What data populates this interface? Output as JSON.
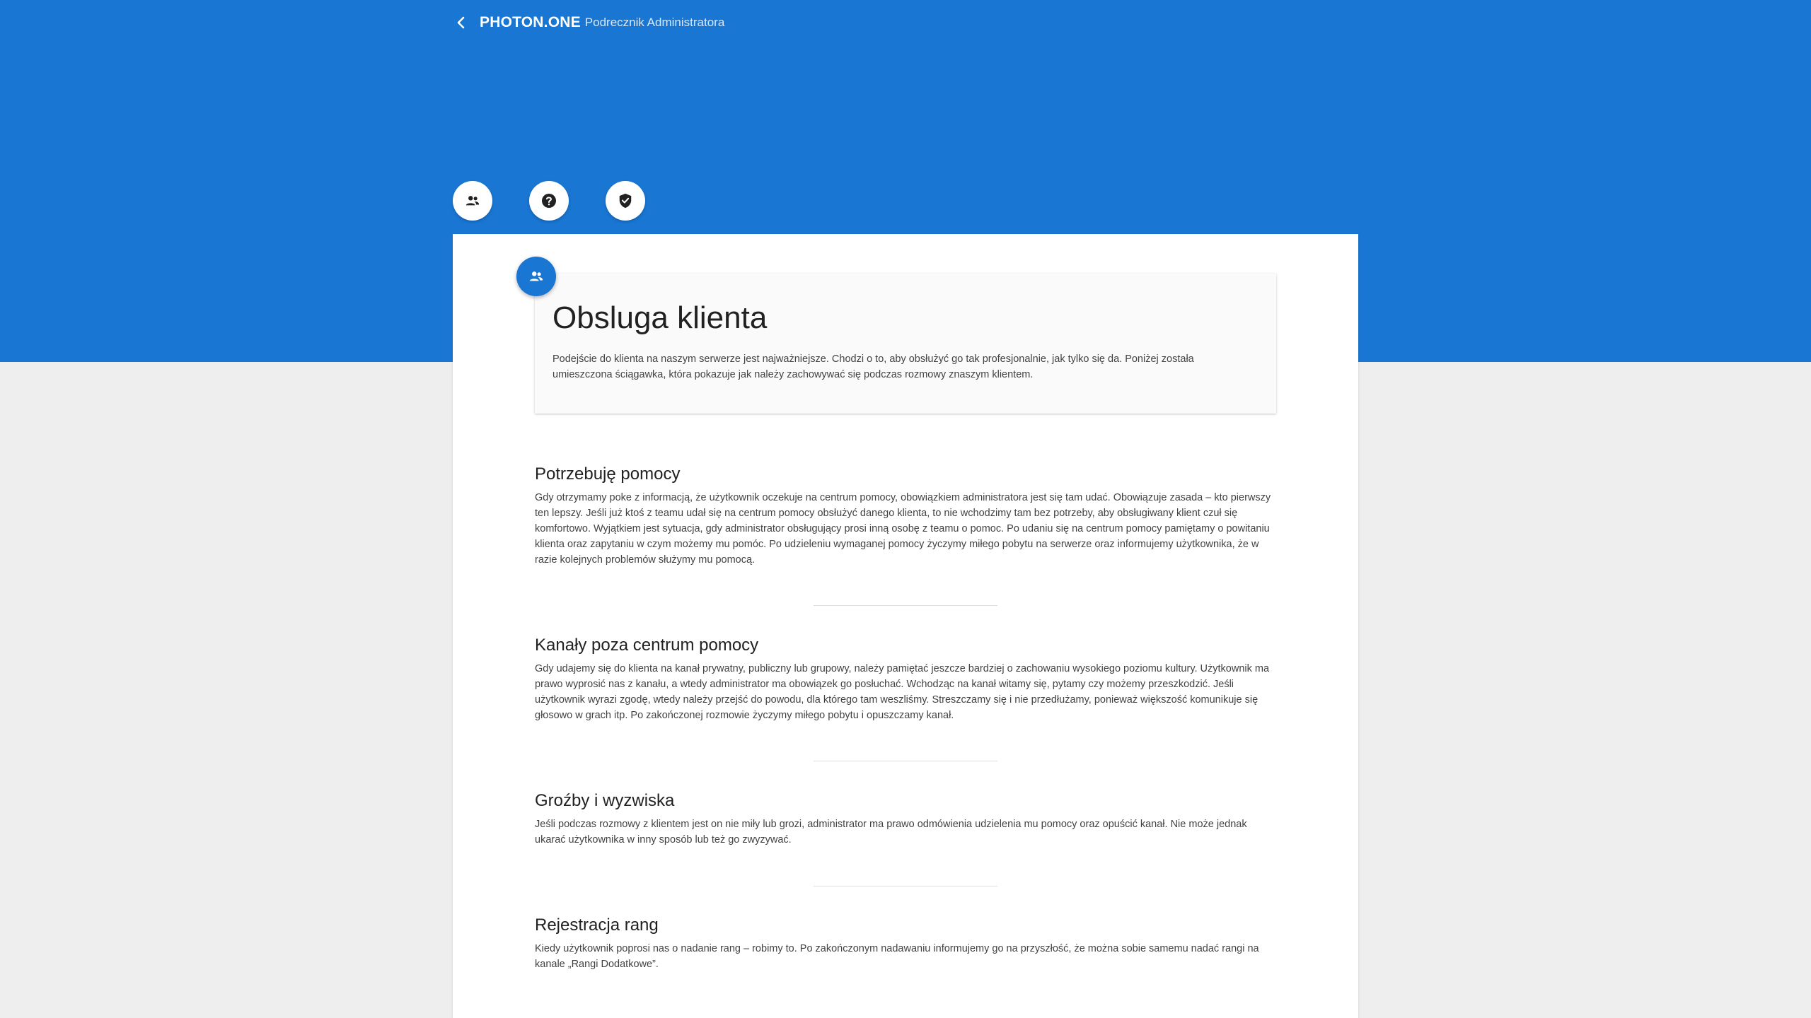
{
  "header": {
    "brand": "PHOTON.ONE",
    "subtitle": "Podrecznik Administratora",
    "back_icon": "chevron-left-icon"
  },
  "colors": {
    "primary": "#1976d2",
    "background": "#eeeeee",
    "card": "#ffffff"
  },
  "tabs": [
    {
      "icon": "people-icon"
    },
    {
      "icon": "help-circle-icon"
    },
    {
      "icon": "shield-check-icon"
    }
  ],
  "intro": {
    "icon": "people-icon",
    "title": "Obsluga klienta",
    "text": "Podejście do klienta na naszym serwerze jest najważniejsze. Chodzi o to, aby obsłużyć go tak profesjonalnie, jak tylko się da. Poniżej została umieszczona ściągawka, która pokazuje jak należy zachowywać się podczas rozmowy znaszym klientem."
  },
  "sections": [
    {
      "title": "Potrzebuję pomocy",
      "text": "Gdy otrzymamy poke z informacją, że użytkownik oczekuje na centrum pomocy, obowiązkiem administratora jest się tam udać. Obowiązuje zasada – kto pierwszy ten lepszy. Jeśli już ktoś z teamu udał się na centrum pomocy obsłużyć danego klienta, to nie wchodzimy tam bez potrzeby, aby obsługiwany klient czuł się komfortowo. Wyjątkiem jest sytuacja, gdy administrator obsługujący prosi inną osobę z teamu o pomoc. Po udaniu się na centrum pomocy pamiętamy o powitaniu klienta oraz zapytaniu w czym możemy mu pomóc. Po udzieleniu wymaganej pomocy życzymy miłego pobytu na serwerze oraz informujemy użytkownika, że w razie kolejnych problemów służymy mu pomocą."
    },
    {
      "title": "Kanały poza centrum pomocy",
      "text": "Gdy udajemy się do klienta na kanał prywatny, publiczny lub grupowy, należy pamiętać jeszcze bardziej o zachowaniu wysokiego poziomu kultury. Użytkownik ma prawo wyprosić nas z kanału, a wtedy administrator ma obowiązek go posłuchać. Wchodząc na kanał witamy się, pytamy czy możemy przeszkodzić. Jeśli użytkownik wyrazi zgodę, wtedy należy przejść do powodu, dla którego tam weszliśmy. Streszczamy się i nie przedłużamy, ponieważ większość komunikuje się głosowo w grach itp. Po zakończonej rozmowie życzymy miłego pobytu i opuszczamy kanał."
    },
    {
      "title": "Groźby i wyzwiska",
      "text": "Jeśli podczas rozmowy z klientem jest on nie miły lub grozi, administrator ma prawo odmówienia udzielenia mu pomocy oraz opuścić kanał. Nie może jednak ukarać użytkownika w inny sposób lub też go zwyzywać."
    },
    {
      "title": "Rejestracja rang",
      "text": "Kiedy użytkownik poprosi nas o nadanie rang – robimy to. Po zakończonym nadawaniu informujemy go na przyszłość, że można sobie samemu nadać rangi na kanale „Rangi Dodatkowe”."
    }
  ]
}
